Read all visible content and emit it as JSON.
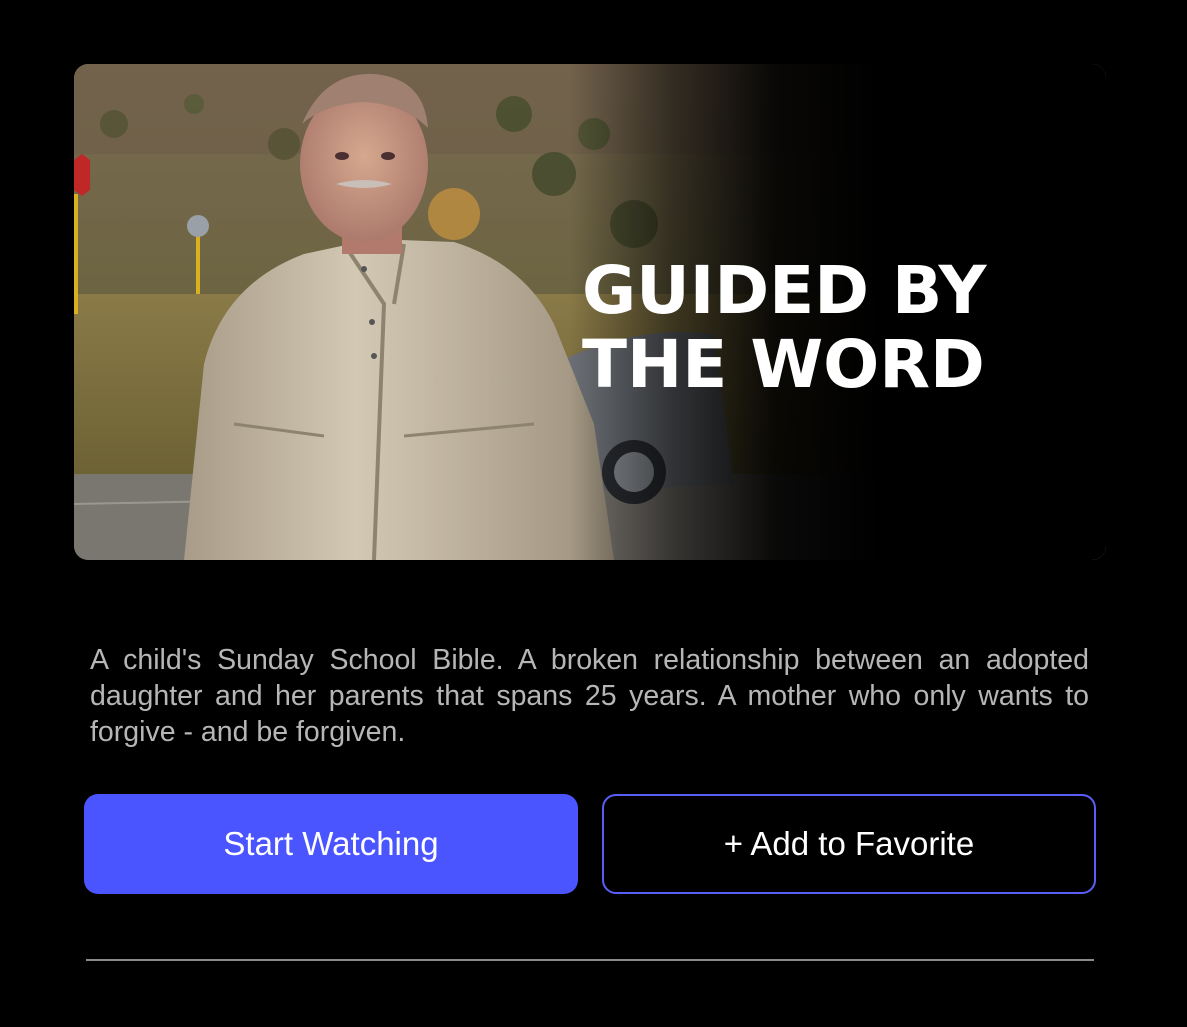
{
  "hero": {
    "title": "GUIDED BY\nTHE WORD"
  },
  "description": "A child's Sunday School Bible. A broken relationship between an adopted daughter and her parents that spans 25 years. A mother who only wants to forgive - and be forgiven.",
  "actions": {
    "start_label": "Start Watching",
    "favorite_label": "+ Add to Favorite"
  },
  "colors": {
    "background": "#000000",
    "primary_button": "#4a55ff",
    "secondary_border": "#5a5ef8",
    "description_text": "#b6b6b6"
  }
}
